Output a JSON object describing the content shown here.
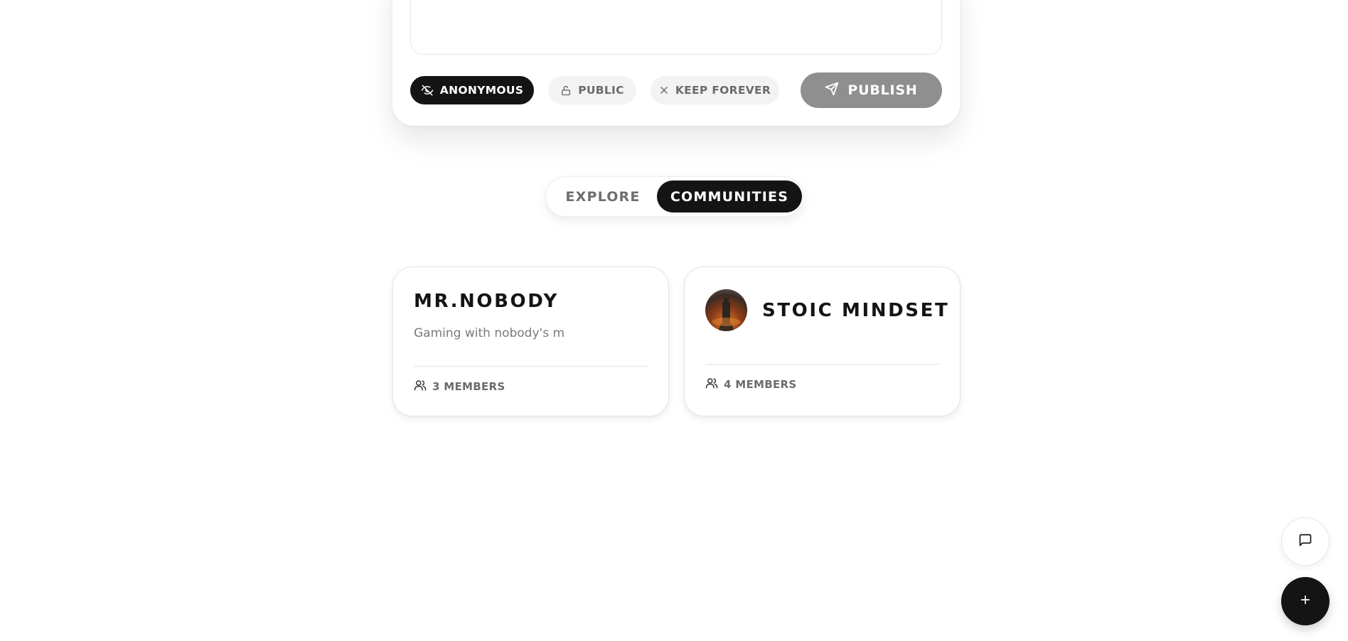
{
  "composer": {
    "chips": {
      "anonymous": "ANONYMOUS",
      "public": "PUBLIC",
      "keep_forever": "KEEP FOREVER"
    },
    "publish_label": "PUBLISH"
  },
  "tabs": {
    "explore": "EXPLORE",
    "communities": "COMMUNITIES",
    "active": "communities"
  },
  "communities": [
    {
      "name": "MR.NOBODY",
      "description": "Gaming with nobody's m",
      "members": "3 MEMBERS"
    },
    {
      "name": "STOIC MINDSET",
      "members": "4 MEMBERS",
      "avatar": "community-avatar-image"
    }
  ],
  "fabs": {
    "chat_icon": "chat-icon",
    "add_icon": "plus-icon"
  },
  "colors": {
    "primary": "#141414",
    "publish_disabled": "#8f8f8f",
    "chip_bg": "#f3f3f3",
    "muted_text": "#6b6b6b"
  }
}
